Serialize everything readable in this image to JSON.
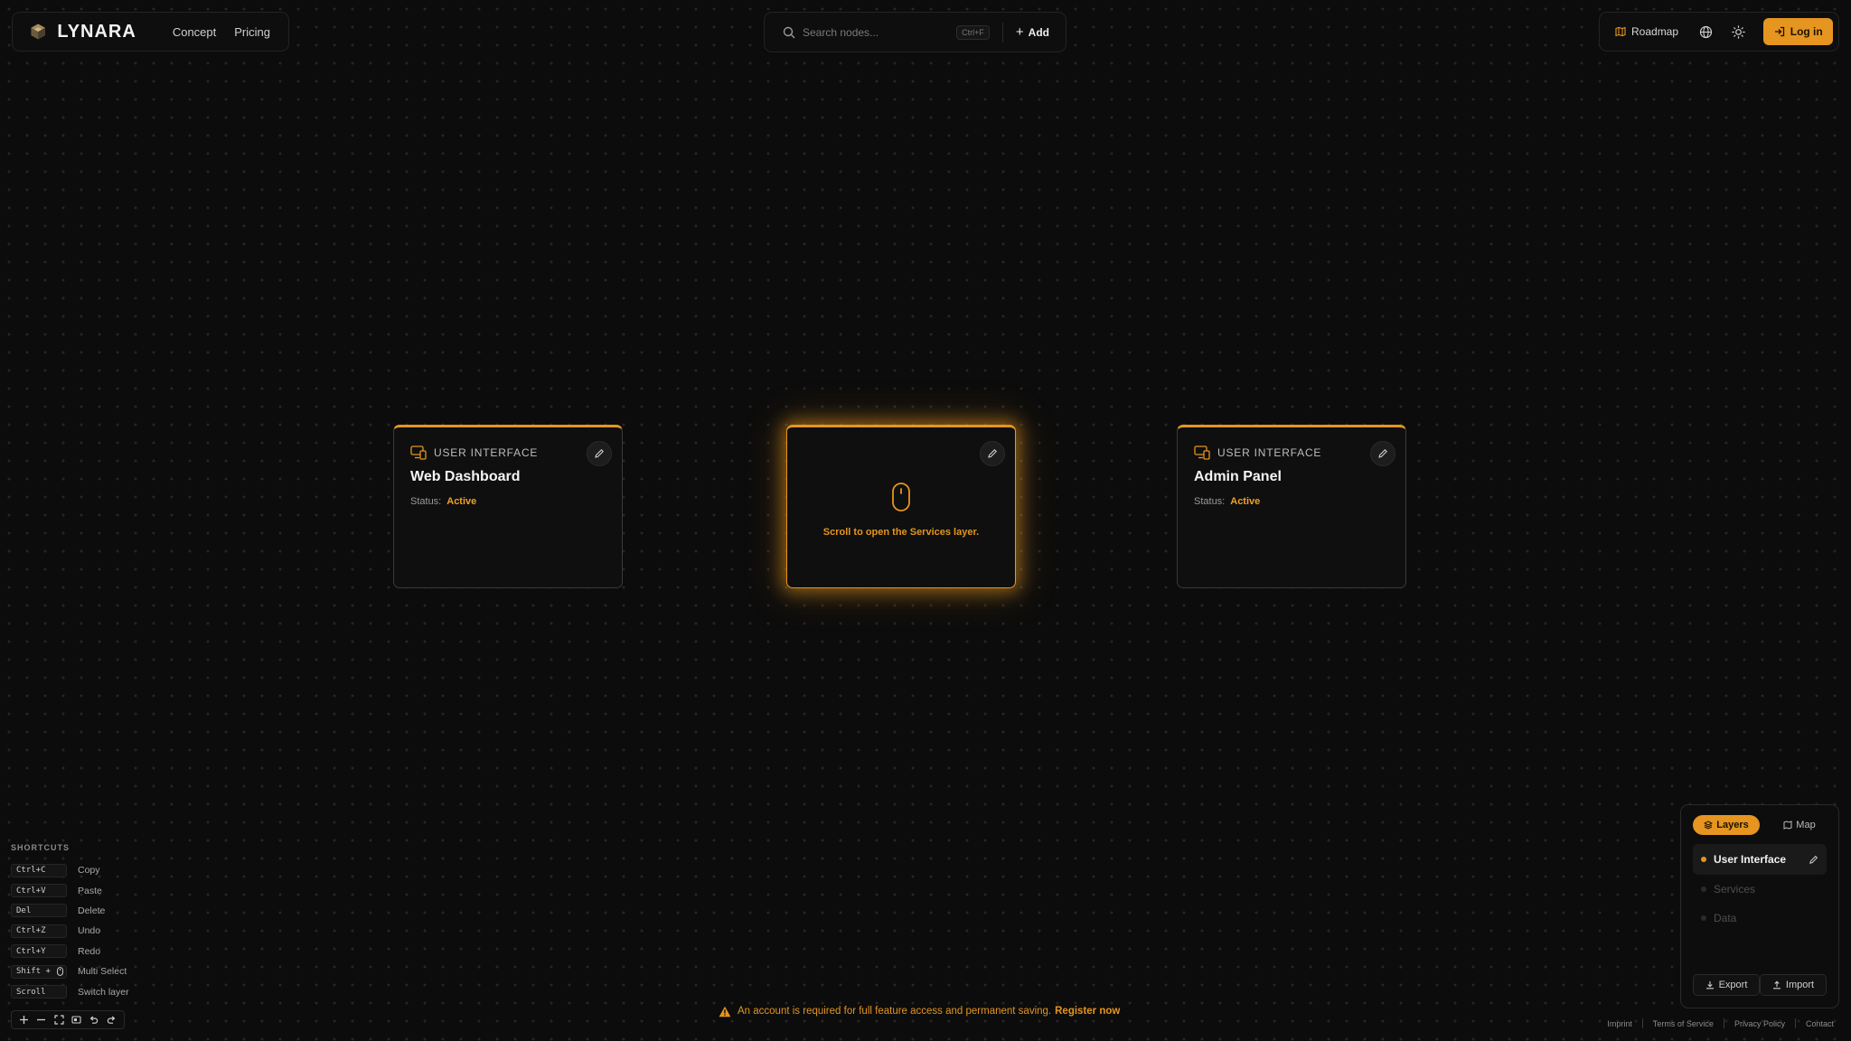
{
  "header": {
    "brand": "LYNARA",
    "nav": [
      "Concept",
      "Pricing"
    ],
    "search_placeholder": "Search nodes...",
    "search_shortcut": "Ctrl+F",
    "add_label": "Add",
    "roadmap_label": "Roadmap",
    "login_label": "Log in"
  },
  "nodes": [
    {
      "type": "USER INTERFACE",
      "title": "Web Dashboard",
      "status_label": "Status:",
      "status": "Active"
    },
    {
      "hint": "Scroll to open the Services layer."
    },
    {
      "type": "USER INTERFACE",
      "title": "Admin Panel",
      "status_label": "Status:",
      "status": "Active"
    }
  ],
  "shortcuts": {
    "title": "SHORTCUTS",
    "items": [
      {
        "key": "Ctrl+C",
        "label": "Copy"
      },
      {
        "key": "Ctrl+V",
        "label": "Paste"
      },
      {
        "key": "Del",
        "label": "Delete"
      },
      {
        "key": "Ctrl+Z",
        "label": "Undo"
      },
      {
        "key": "Ctrl+Y",
        "label": "Redo"
      },
      {
        "key": "Shift + ",
        "label": "Multi Select"
      },
      {
        "key": "Scroll",
        "label": "Switch layer"
      }
    ]
  },
  "layers_panel": {
    "tabs": [
      "Layers",
      "Map"
    ],
    "layers": [
      "User Interface",
      "Services",
      "Data"
    ],
    "export_label": "Export",
    "import_label": "Import"
  },
  "notice": {
    "text": "An account is required for full feature access and permanent saving.",
    "link": "Register now"
  },
  "footer": [
    "Imprint",
    "Terms of Service",
    "Privacy Policy",
    "Contact"
  ],
  "colors": {
    "accent": "#e5951f",
    "background": "#0c0c0c",
    "panel": "#0e0e0e"
  }
}
